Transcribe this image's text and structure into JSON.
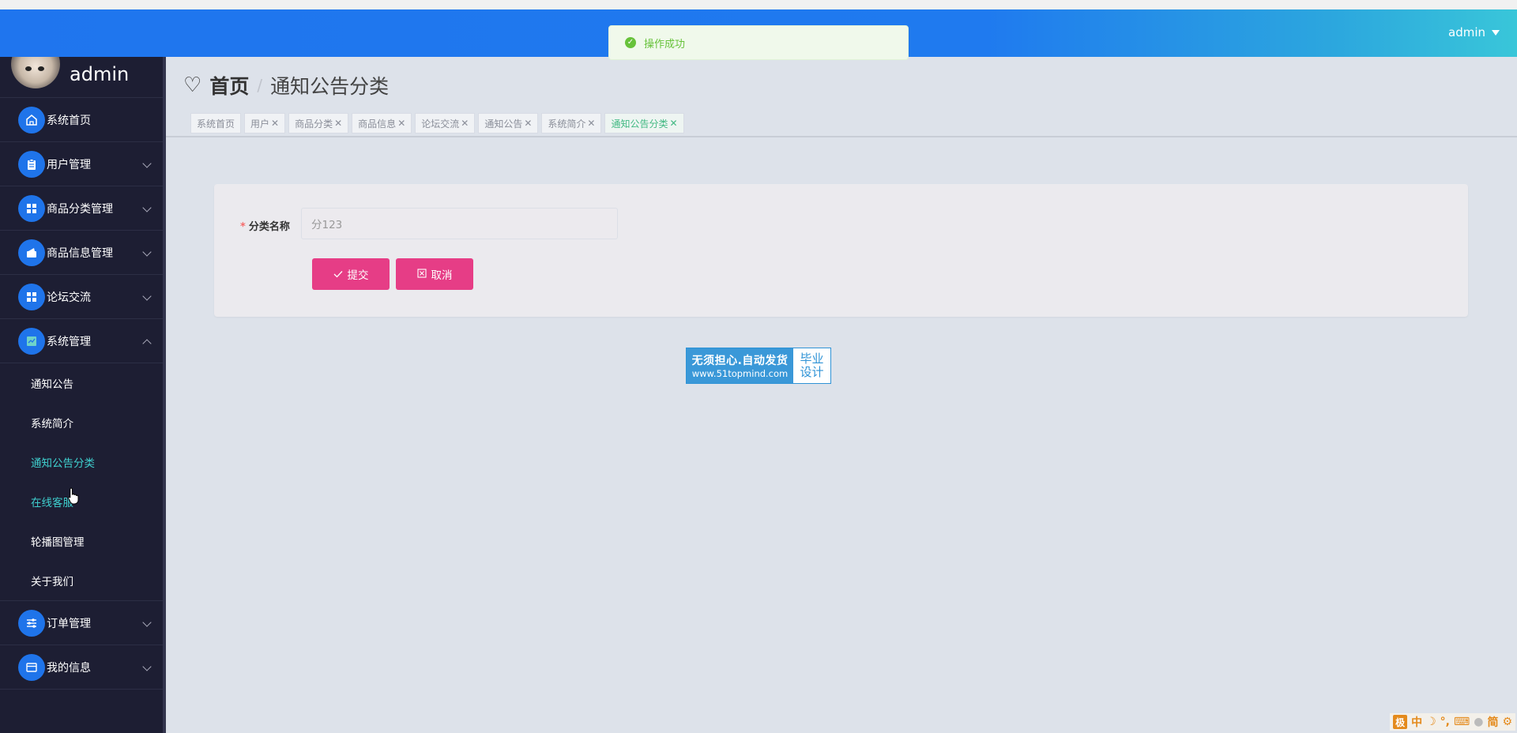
{
  "topbar": {
    "user": "admin"
  },
  "toast": {
    "text": "操作成功"
  },
  "sidebar": {
    "brand": "admin",
    "items": [
      {
        "label": "系统首页"
      },
      {
        "label": "用户管理"
      },
      {
        "label": "商品分类管理"
      },
      {
        "label": "商品信息管理"
      },
      {
        "label": "论坛交流"
      },
      {
        "label": "系统管理"
      }
    ],
    "sub_items": [
      {
        "label": "通知公告"
      },
      {
        "label": "系统简介"
      },
      {
        "label": "通知公告分类"
      },
      {
        "label": "在线客服"
      },
      {
        "label": "轮播图管理"
      },
      {
        "label": "关于我们"
      }
    ],
    "bottom_items": [
      {
        "label": "订单管理"
      },
      {
        "label": "我的信息"
      }
    ]
  },
  "breadcrumb": {
    "home": "首页",
    "current": "通知公告分类"
  },
  "tabs": [
    {
      "label": "系统首页"
    },
    {
      "label": "用户"
    },
    {
      "label": "商品分类"
    },
    {
      "label": "商品信息"
    },
    {
      "label": "论坛交流"
    },
    {
      "label": "通知公告"
    },
    {
      "label": "系统简介"
    },
    {
      "label": "通知公告分类"
    }
  ],
  "form": {
    "field_label": "分类名称",
    "field_value": "分123",
    "submit_label": "提交",
    "cancel_label": "取消"
  },
  "ad": {
    "line1": "无须担心.自动发货",
    "line2": "www.51topmind.com",
    "right1": "毕业",
    "right2": "设计"
  },
  "ime": {
    "logo": "极",
    "lang": "中",
    "mode": "简"
  }
}
